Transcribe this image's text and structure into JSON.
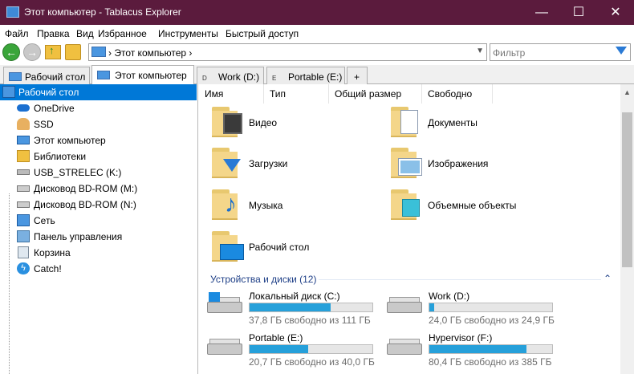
{
  "window": {
    "title": "Этот компьютер - Tablacus Explorer",
    "minimize": "—",
    "maximize": "☐",
    "close": "✕"
  },
  "menu": [
    "Файл",
    "Правка",
    "Вид",
    "Избранное",
    "Инструменты",
    "Быстрый доступ"
  ],
  "address": {
    "path": "› Этот компьютер ›",
    "filter_placeholder": "Фильтр"
  },
  "tabs": [
    {
      "label": "Рабочий стол",
      "icon": "monitor-icon"
    },
    {
      "label": "Этот компьютер",
      "icon": "monitor-icon",
      "active": true
    },
    {
      "label": "Work (D:)",
      "icon": "drive-icon",
      "letter": "D"
    },
    {
      "label": "Portable (E:)",
      "icon": "drive-icon",
      "letter": "E"
    },
    {
      "label": "+"
    }
  ],
  "tree": [
    {
      "label": "Рабочий стол",
      "icon": "desktop-icon",
      "selected": true
    },
    {
      "label": "OneDrive",
      "icon": "cloud-icon"
    },
    {
      "label": "SSD",
      "icon": "user-icon"
    },
    {
      "label": "Этот компьютер",
      "icon": "monitor-icon"
    },
    {
      "label": "Библиотеки",
      "icon": "library-icon"
    },
    {
      "label": "USB_STRELEC (K:)",
      "icon": "usb-drive-icon"
    },
    {
      "label": "Дисковод BD-ROM (M:)",
      "icon": "optical-drive-icon"
    },
    {
      "label": "Дисковод BD-ROM (N:)",
      "icon": "optical-drive-icon"
    },
    {
      "label": "Сеть",
      "icon": "network-icon"
    },
    {
      "label": "Панель управления",
      "icon": "control-panel-icon"
    },
    {
      "label": "Корзина",
      "icon": "recycle-bin-icon"
    },
    {
      "label": "Catch!",
      "icon": "lightning-icon"
    }
  ],
  "columns": [
    "Имя",
    "Тип",
    "Общий размер",
    "Свободно"
  ],
  "folders": [
    {
      "label": "Видео",
      "icon": "video-folder-icon"
    },
    {
      "label": "Документы",
      "icon": "documents-folder-icon"
    },
    {
      "label": "Загрузки",
      "icon": "downloads-folder-icon"
    },
    {
      "label": "Изображения",
      "icon": "pictures-folder-icon"
    },
    {
      "label": "Музыка",
      "icon": "music-folder-icon"
    },
    {
      "label": "Объемные объекты",
      "icon": "3d-objects-folder-icon"
    },
    {
      "label": "Рабочий стол",
      "icon": "desktop-folder-icon"
    }
  ],
  "devices_group": {
    "label": "Устройства и диски (12)",
    "collapse": "⌃"
  },
  "drives": [
    {
      "name": "Локальный диск (C:)",
      "free": "37,8 ГБ свободно из 111 ГБ",
      "used_fraction": 0.66,
      "icon": "windows-drive-icon"
    },
    {
      "name": "Work (D:)",
      "free": "24,0 ГБ свободно из 24,9 ГБ",
      "used_fraction": 0.04,
      "icon": "hdd-icon"
    },
    {
      "name": "Portable (E:)",
      "free": "20,7 ГБ свободно из 40,0 ГБ",
      "used_fraction": 0.48,
      "icon": "hdd-icon"
    },
    {
      "name": "Hypervisor (F:)",
      "free": "80,4 ГБ свободно из 385 ГБ",
      "used_fraction": 0.79,
      "icon": "hdd-icon"
    }
  ],
  "colors": {
    "titlebar": "#5b1b3d",
    "accent": "#0078d7",
    "bar_fill": "#26a0da",
    "group_text": "#1e3f87"
  }
}
